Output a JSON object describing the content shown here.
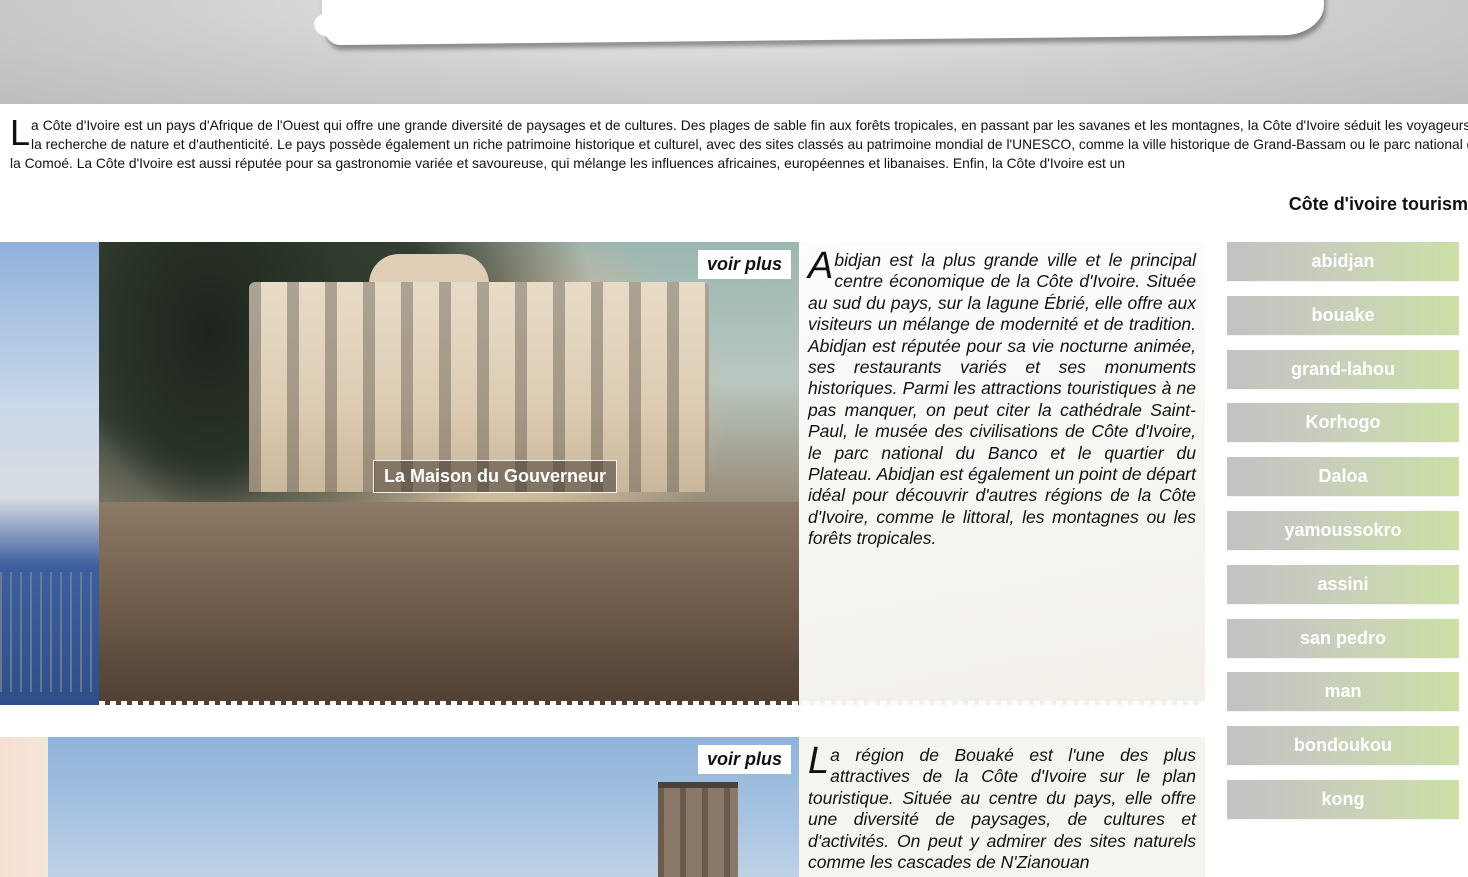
{
  "intro": {
    "dropcap": "L",
    "text": "a Côte d'Ivoire est un pays d'Afrique de l'Ouest qui offre une grande diversité de paysages et de cultures. Des plages de sable fin aux forêts tropicales, en passant par les savanes et les montagnes, la Côte d'Ivoire séduit les voyageurs à la recherche de nature et d'authenticité. Le pays possède également un riche patrimoine historique et culturel, avec des sites classés au patrimoine mondial de l'UNESCO, comme la ville historique de Grand-Bassam ou le parc national de la Comoé. La Côte d'Ivoire est aussi réputée pour sa gastronomie variée et savoureuse, qui mélange les influences africaines, européennes et libanaises. Enfin, la Côte d'Ivoire est un"
  },
  "site_title": "Côte d'ivoire tourism",
  "cards": [
    {
      "voir_plus": "voir plus",
      "caption": "La Maison du Gouverneur",
      "dropcap": "A",
      "text": "bidjan est la plus grande ville et le principal centre économique de la Côte d'Ivoire. Située au sud du pays, sur la lagune Ébrié, elle offre aux visiteurs un mélange de modernité et de tradition. Abidjan est réputée pour sa vie nocturne animée, ses restaurants variés et ses monuments historiques. Parmi les attractions touristiques à ne pas manquer, on peut citer la cathédrale Saint-Paul, le musée des civilisations de Côte d'Ivoire, le parc national du Banco et le quartier du Plateau. Abidjan est également un point de départ idéal pour découvrir d'autres régions de la Côte d'Ivoire, comme le littoral, les montagnes ou les forêts tropicales."
    },
    {
      "voir_plus": "voir plus",
      "dropcap": "L",
      "text": "a région de Bouaké est l'une des plus attractives de la Côte d'Ivoire sur le plan touristique. Située au centre du pays, elle offre une diversité de paysages, de cultures et d'activités. On peut y admirer des sites naturels comme les cascades de N'Zianouan"
    }
  ],
  "nav": [
    "abidjan",
    "bouake",
    "grand-lahou",
    "Korhogo",
    "Daloa",
    "yamoussokro",
    "assini",
    "san pedro",
    "man",
    "bondoukou",
    "kong"
  ]
}
